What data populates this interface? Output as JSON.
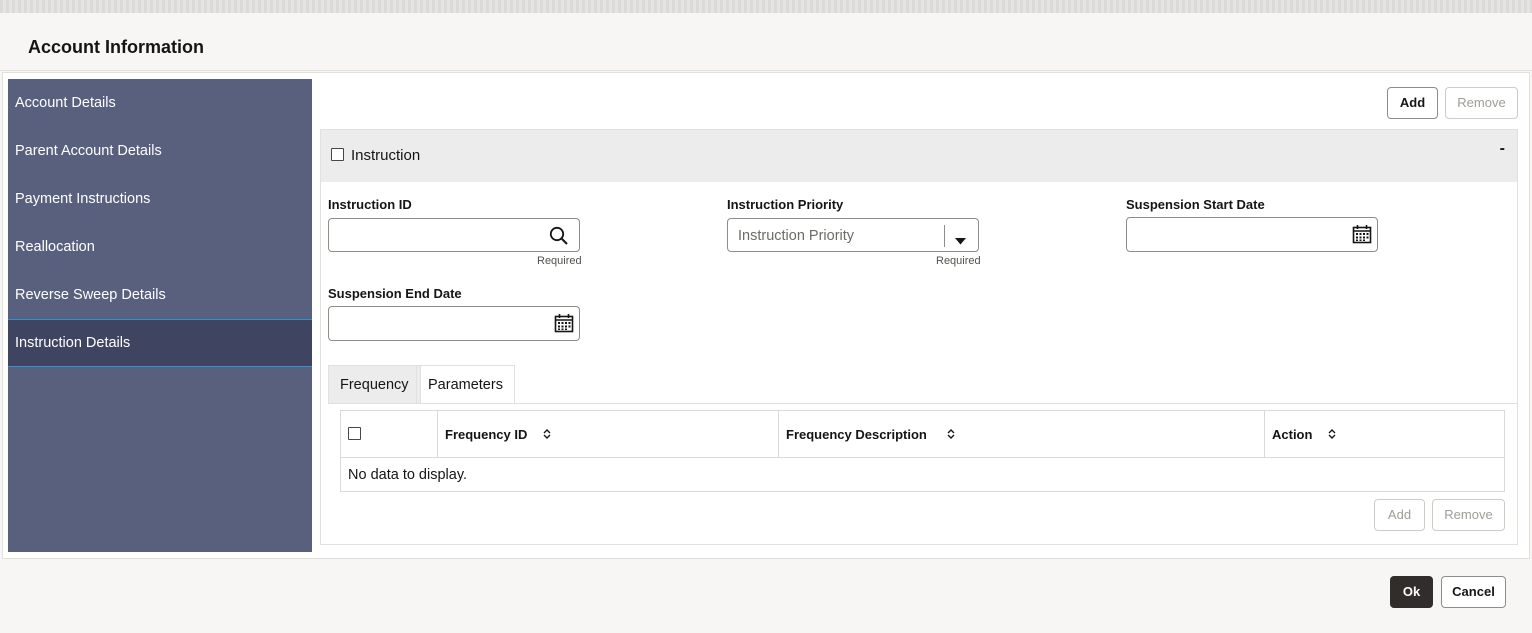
{
  "page": {
    "title": "Account Information"
  },
  "sidebar": {
    "items": [
      {
        "label": "Account Details"
      },
      {
        "label": "Parent Account Details"
      },
      {
        "label": "Payment Instructions"
      },
      {
        "label": "Reallocation"
      },
      {
        "label": "Reverse Sweep Details"
      },
      {
        "label": "Instruction Details",
        "active": true
      }
    ]
  },
  "toolbar": {
    "add_label": "Add",
    "remove_label": "Remove"
  },
  "section": {
    "title": "Instruction",
    "collapse_label": "-"
  },
  "form": {
    "instruction_id": {
      "label": "Instruction ID",
      "value": "",
      "hint": "Required"
    },
    "instruction_priority": {
      "label": "Instruction Priority",
      "placeholder": "Instruction Priority",
      "hint": "Required"
    },
    "suspension_start_date": {
      "label": "Suspension Start Date",
      "value": ""
    },
    "suspension_end_date": {
      "label": "Suspension End Date",
      "value": ""
    }
  },
  "tabs": [
    {
      "label": "Frequency",
      "active": true
    },
    {
      "label": "Parameters",
      "active": false
    }
  ],
  "table": {
    "columns": [
      "Frequency ID",
      "Frequency Description",
      "Action"
    ],
    "empty_text": "No data to display.",
    "add_label": "Add",
    "remove_label": "Remove"
  },
  "footer": {
    "ok_label": "Ok",
    "cancel_label": "Cancel"
  },
  "icons": {
    "search": "search-icon",
    "calendar": "calendar-icon",
    "dropdown": "chevron-down-icon",
    "sort": "sort-icon"
  },
  "colors": {
    "sidebar_bg": "#59607e",
    "sidebar_active": "#3f4560",
    "primary_button": "#312d2a"
  }
}
